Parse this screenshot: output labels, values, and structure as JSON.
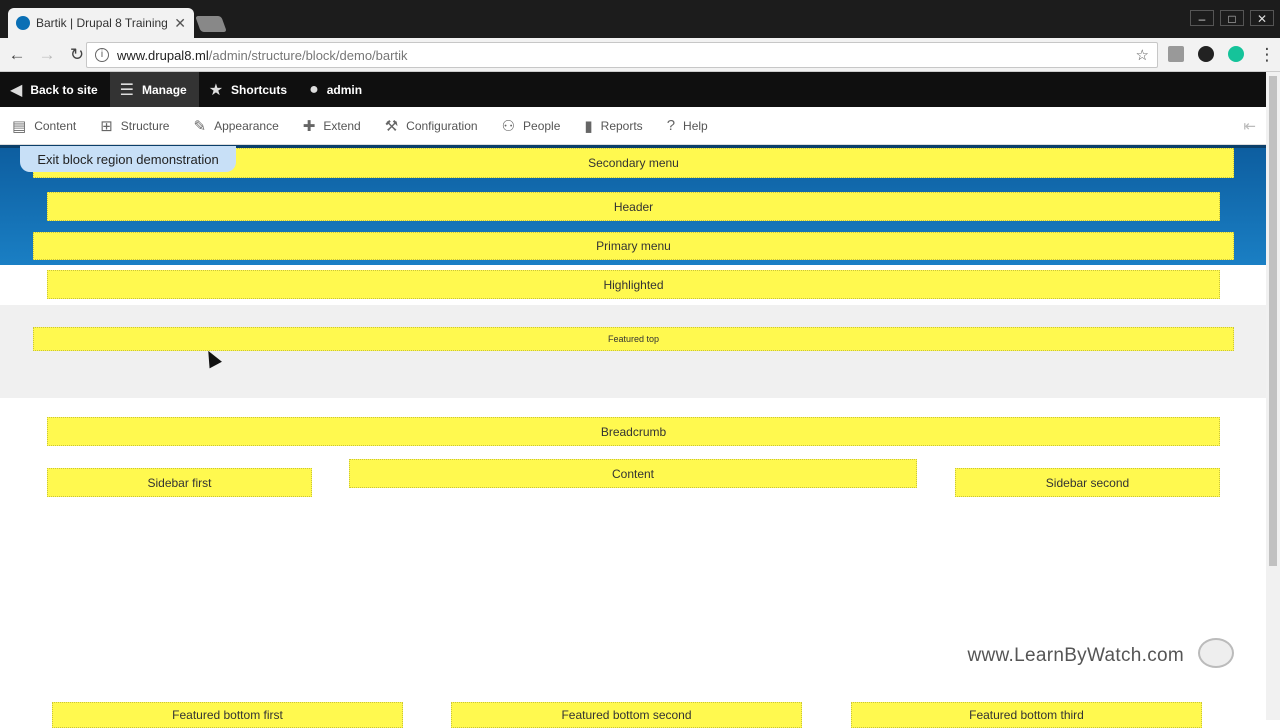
{
  "browser": {
    "tab_title": "Bartik | Drupal 8 Training",
    "url_host": "www.drupal8.ml",
    "url_path": "/admin/structure/block/demo/bartik"
  },
  "admin_toolbar": {
    "back": "Back to site",
    "manage": "Manage",
    "shortcuts": "Shortcuts",
    "user": "admin"
  },
  "tray": {
    "items": [
      "Content",
      "Structure",
      "Appearance",
      "Extend",
      "Configuration",
      "People",
      "Reports",
      "Help"
    ]
  },
  "demo": {
    "exit_label": "Exit block region demonstration",
    "regions": {
      "secondary_menu": "Secondary menu",
      "header": "Header",
      "primary_menu": "Primary menu",
      "highlighted": "Highlighted",
      "featured_top": "Featured top",
      "breadcrumb": "Breadcrumb",
      "content": "Content",
      "sidebar_first": "Sidebar first",
      "sidebar_second": "Sidebar second",
      "featured_bottom_first": "Featured bottom first",
      "featured_bottom_second": "Featured bottom second",
      "featured_bottom_third": "Featured bottom third"
    }
  },
  "watermark": "www.LearnByWatch.com",
  "colors": {
    "region": "#fff94f",
    "band": "#1a7fc4"
  }
}
